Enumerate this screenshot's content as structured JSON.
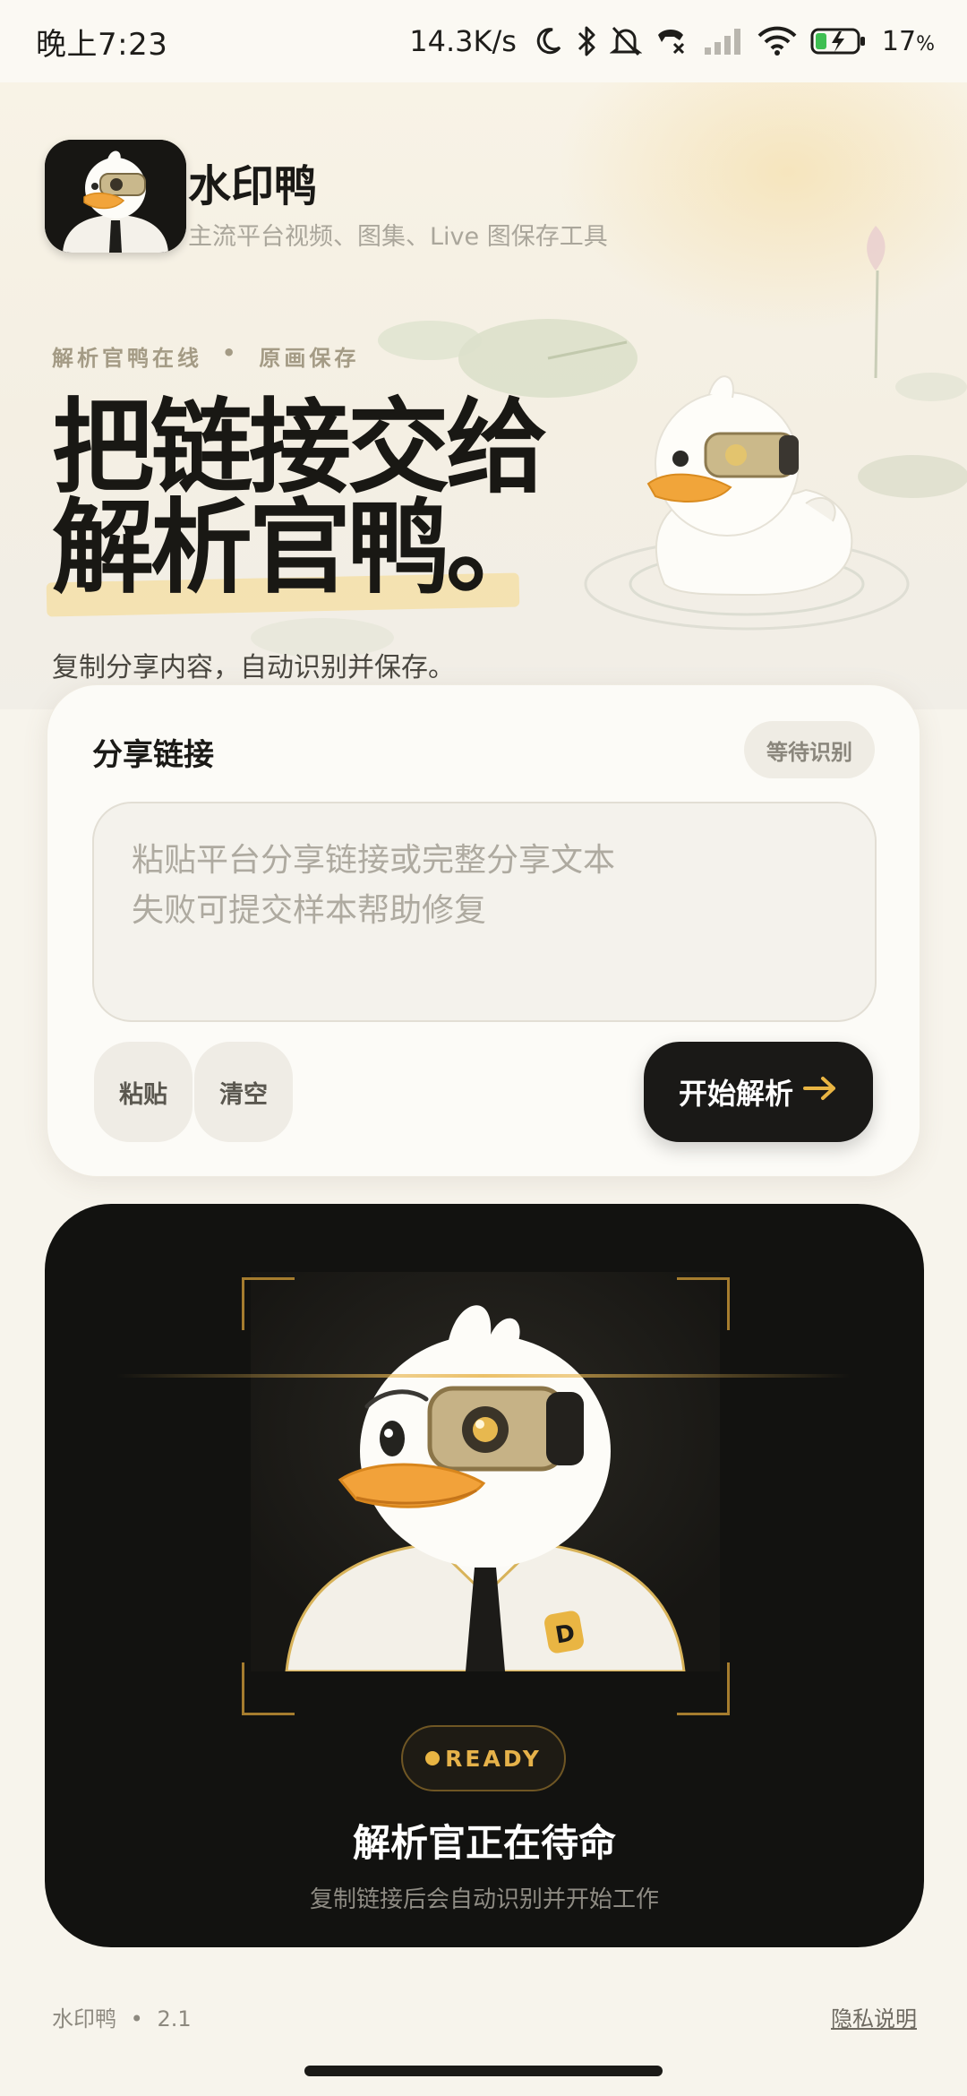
{
  "status_bar": {
    "time": "晚上7:23",
    "network_speed": "14.3K/s",
    "battery_percent": "17",
    "battery_unit": "%",
    "icons": [
      "moon-icon",
      "bluetooth-icon",
      "mute-icon",
      "call-icon",
      "signal-icon",
      "wifi-icon",
      "battery-icon"
    ]
  },
  "app": {
    "name": "水印鸭",
    "tagline": "主流平台视频、图集、Live 图保存工具"
  },
  "hero": {
    "kicker_left": "解析官鸭在线",
    "kicker_sep": "•",
    "kicker_right": "原画保存",
    "title_line1": "把链接交给",
    "title_line2": "解析官鸭。",
    "subtitle": "复制分享内容，自动识别并保存。"
  },
  "share_card": {
    "title": "分享链接",
    "status": "等待识别",
    "input_value": "",
    "placeholder": "粘贴平台分享链接或完整分享文本\n失败可提交样本帮助修复",
    "paste_label": "粘贴",
    "clear_label": "清空",
    "start_label": "开始解析",
    "start_icon": "arrow-right-icon"
  },
  "ready_panel": {
    "badge": "READY",
    "title": "解析官正在待命",
    "subtitle": "复制链接后会自动识别并开始工作"
  },
  "footer": {
    "app_name": "水印鸭",
    "separator": "•",
    "version": "2.1",
    "privacy_link": "隐私说明"
  },
  "colors": {
    "accent_gold": "#e6b24a",
    "dark_panel": "#121210",
    "button_dark": "#1a1917",
    "highlight": "#f4dfa8"
  }
}
